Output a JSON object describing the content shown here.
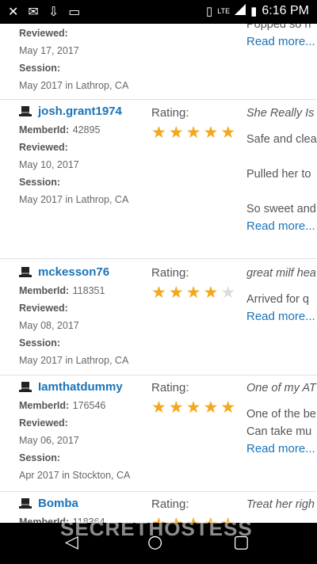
{
  "status_bar": {
    "left_icons": [
      "missed-call-icon",
      "message-icon",
      "download-icon",
      "voicemail-icon"
    ],
    "left_glyphs": [
      "✕",
      "✉",
      "⇩",
      "▭"
    ],
    "vibrate_glyph": "▯",
    "network_label": "LTE",
    "battery_glyph": "▮",
    "time": "6:16 PM"
  },
  "labels": {
    "reviewed": "Reviewed:",
    "session": "Session:",
    "memberid": "MemberId:",
    "rating": "Rating:",
    "read_more": "Read more..."
  },
  "top_partial": {
    "reviewed_label": "Reviewed:",
    "reviewed_date": "May 17, 2017",
    "session_label": "Session:",
    "session_value": "May 2017 in Lathrop, CA",
    "right_text": "Popped so h",
    "read_more": "Read more..."
  },
  "reviews": [
    {
      "name": "josh.grant1974",
      "memberid_label": "MemberId:",
      "memberid": "42895",
      "reviewed_label": "Reviewed:",
      "reviewed": "May 10, 2017",
      "session_label": "Session:",
      "session": "May 2017 in Lathrop, CA",
      "rating_label": "Rating:",
      "stars": 5,
      "headline": "She Really Is",
      "lines": [
        "Safe and clea",
        "Pulled her to",
        "So sweet and"
      ],
      "read_more": "Read more..."
    },
    {
      "name": "mckesson76",
      "memberid_label": "MemberId:",
      "memberid": "118351",
      "reviewed_label": "Reviewed:",
      "reviewed": "May 08, 2017",
      "session_label": "Session:",
      "session": "May 2017 in Lathrop, CA",
      "rating_label": "Rating:",
      "stars": 4,
      "headline": "great milf hea",
      "lines": [
        "Arrived for q"
      ],
      "read_more": "Read more..."
    },
    {
      "name": "Iamthatdummy",
      "memberid_label": "MemberId:",
      "memberid": "176546",
      "reviewed_label": "Reviewed:",
      "reviewed": "May 06, 2017",
      "session_label": "Session:",
      "session": "Apr 2017 in Stockton, CA",
      "rating_label": "Rating:",
      "stars": 5,
      "headline": "One of my AT",
      "lines": [
        "One of the be",
        "Can take mu"
      ],
      "read_more": "Read more..."
    },
    {
      "name": "Bomba",
      "memberid_label": "MemberId:",
      "memberid": "118364",
      "rating_label": "Rating:",
      "stars": 5,
      "headline": "Treat her righ"
    }
  ],
  "nav_bar": {
    "back_glyph": "◁",
    "home_glyph": "○",
    "recents_glyph": "▢"
  },
  "watermark": "SECRETHOSTESS"
}
